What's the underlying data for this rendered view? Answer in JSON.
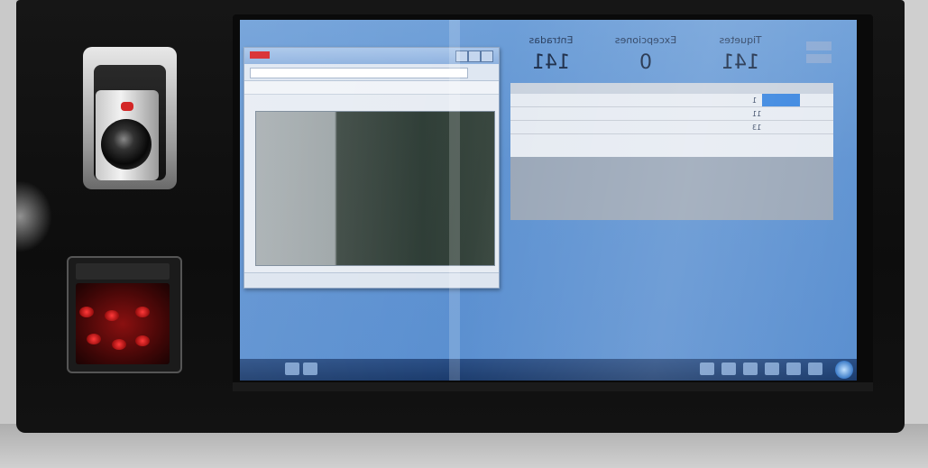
{
  "scene": {
    "description_free": true
  },
  "screen_app": {
    "stats": [
      {
        "label": "Tiquetes",
        "value": "141"
      },
      {
        "label": "Excepciones",
        "value": "0"
      },
      {
        "label": "Entradas",
        "value": "141"
      }
    ],
    "rows": [
      {
        "a": "1",
        "b": "",
        "c": "",
        "d": ""
      },
      {
        "a": "11",
        "b": "",
        "c": "",
        "d": ""
      },
      {
        "a": "13",
        "b": "",
        "c": "",
        "d": ""
      }
    ]
  },
  "colors": {
    "screen_blue": "#5f93d2",
    "taskbar": "#1b3b6c",
    "scanner_red": "#8a1010",
    "app_badge": "#d7262b"
  },
  "icons": [
    "camera-icon",
    "fingerprint-scanner-icon",
    "windows-start-icon"
  ]
}
